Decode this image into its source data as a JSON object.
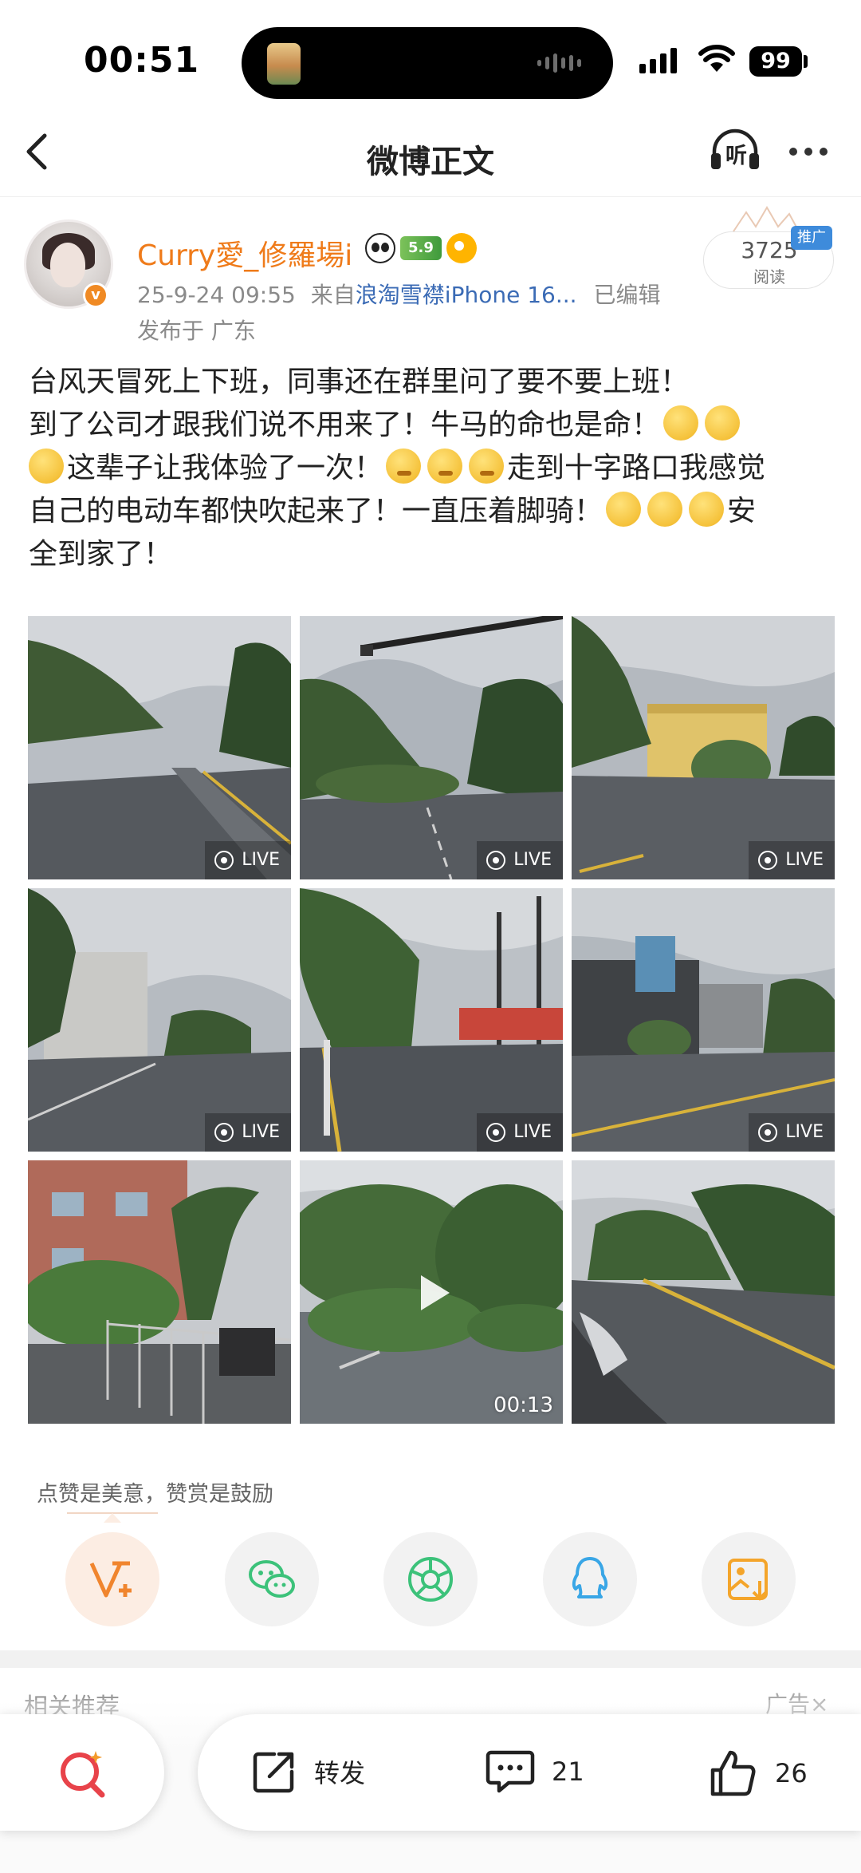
{
  "status_bar": {
    "time": "00:51",
    "battery": "99"
  },
  "nav": {
    "title": "微博正文",
    "listen_label": "听"
  },
  "author": {
    "name": "Curry愛_修羅場i",
    "level_badge": "5.9",
    "verified_badge": "v",
    "meta_time": "25-9-24 09:55",
    "meta_from": "来自",
    "meta_source": "浪淘雪襟iPhone 16...",
    "meta_edited": "已编辑",
    "location": "发布于 广东"
  },
  "read_stats": {
    "count": "3725",
    "label": "阅读",
    "promo_tag": "推广"
  },
  "post": {
    "line1": "台风天冒死上下班，同事还在群里问了要不要上班！",
    "line2": "到了公司才跟我们说不用来了！牛马的命也是命！",
    "line3": "这辈子让我体验了一次！",
    "line3b": "走到十字路口我感觉",
    "line4": "自己的电动车都快吹起来了！一直压着脚骑！",
    "line4b": "安",
    "line5": "全到家了！"
  },
  "photos": {
    "live_label": "LIVE",
    "video_duration": "00:13",
    "items": [
      {
        "kind": "live",
        "scene": "wet-road-trees"
      },
      {
        "kind": "live",
        "scene": "traffic-pole-fallen-tree"
      },
      {
        "kind": "live",
        "scene": "yellow-building-fallen-tree"
      },
      {
        "kind": "live",
        "scene": "empty-street"
      },
      {
        "kind": "live",
        "scene": "bent-tree-shops"
      },
      {
        "kind": "live",
        "scene": "corner-store-street"
      },
      {
        "kind": "image",
        "scene": "fallen-tree-fence"
      },
      {
        "kind": "video",
        "scene": "flooded-fallen-trees"
      },
      {
        "kind": "image",
        "scene": "wet-road-leaves"
      }
    ]
  },
  "reward": {
    "hint": "点赞是美意，赞赏是鼓励"
  },
  "share_targets": [
    "reward-v-plus",
    "wechat",
    "moments",
    "qq",
    "save-image"
  ],
  "related": {
    "title": "相关推荐",
    "ad": "广告×"
  },
  "bottom_bar": {
    "repost_label": "转发",
    "comment_count": "21",
    "like_count": "26"
  },
  "colors": {
    "accent_orange": "#ef7b1a",
    "link_blue": "#3b6bb5",
    "wechat_green": "#3cc27a",
    "qq_blue": "#39a6e6",
    "save_orange": "#f4a52b"
  }
}
